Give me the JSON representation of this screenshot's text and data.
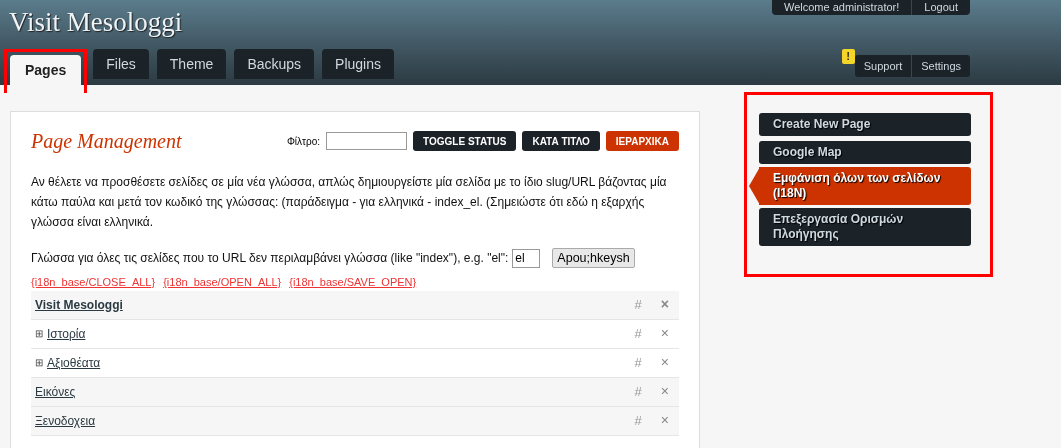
{
  "site_title": "Visit Mesologgi",
  "user_menu": [
    "Welcome administrator!",
    "Logout"
  ],
  "tabs": [
    {
      "label": "Pages",
      "selected": true,
      "highlighted": true
    },
    {
      "label": "Files",
      "selected": false,
      "highlighted": false
    },
    {
      "label": "Theme",
      "selected": false,
      "highlighted": false
    },
    {
      "label": "Backups",
      "selected": false,
      "highlighted": false
    },
    {
      "label": "Plugins",
      "selected": false,
      "highlighted": false
    }
  ],
  "utility_menu": [
    {
      "label": "Support",
      "alert": "!"
    },
    {
      "label": "Settings"
    }
  ],
  "panel": {
    "title": "Page Management",
    "filter_label": "Φίλτρο:",
    "sort_buttons": [
      {
        "label": "TOGGLE STATUS",
        "selected": false
      },
      {
        "label": "ΚΑΤΑ ΤΙΤΛΟ",
        "selected": false
      },
      {
        "label": "ΙΕΡΑΡΧΙΚΑ",
        "selected": true
      }
    ],
    "intro": "Αν θέλετε να προσθέσετε σελίδες σε μία νέα γλώσσα, απλώς δημιουργείστε μία σελίδα με το ίδιο slug/URL βάζοντας μία κάτω παύλα και μετά τον κωδικό της γλώσσας: (παράδειγμα - για ελληνικά - index_el. (Σημειώστε ότι εδώ η εξαρχής γλώσσα είναι ελληνικά.",
    "language_label": "Γλώσσα για όλες τις σελίδες που το URL δεν περιλαμβάνει γλώσσα (like \"index\"), e.g. \"el\":",
    "language_value": "el",
    "save_button": "Apou;hkeysh",
    "tree_links": [
      "{i18n_base/CLOSE_ALL}",
      "{i18n_base/OPEN_ALL}",
      "{i18n_base/SAVE_OPEN}"
    ],
    "pages": [
      {
        "title": "Visit Mesologgi",
        "kind": "root",
        "hash": "#",
        "delete": "×"
      },
      {
        "title": "Ιστορία",
        "kind": "page",
        "expander": "⊞",
        "hash": "#",
        "delete": "×"
      },
      {
        "title": "Αξιοθέατα",
        "kind": "page",
        "expander": "⊞",
        "hash": "#",
        "delete": "×"
      },
      {
        "title": "Εικόνες",
        "kind": "page",
        "hash": "#",
        "delete": "×"
      },
      {
        "title": "Ξενοδοχεια",
        "kind": "page",
        "hash": "#",
        "delete": "×"
      }
    ]
  },
  "sidebar": {
    "highlighted": true,
    "items": [
      {
        "label": "Create New Page",
        "selected": false
      },
      {
        "label": "Google Map",
        "selected": false
      },
      {
        "label": "Εμφάνιση όλων των σελίδων (I18N)",
        "selected": true
      },
      {
        "label": "Επεξεργασία Ορισμών Πλοήγησης",
        "selected": false
      }
    ]
  }
}
